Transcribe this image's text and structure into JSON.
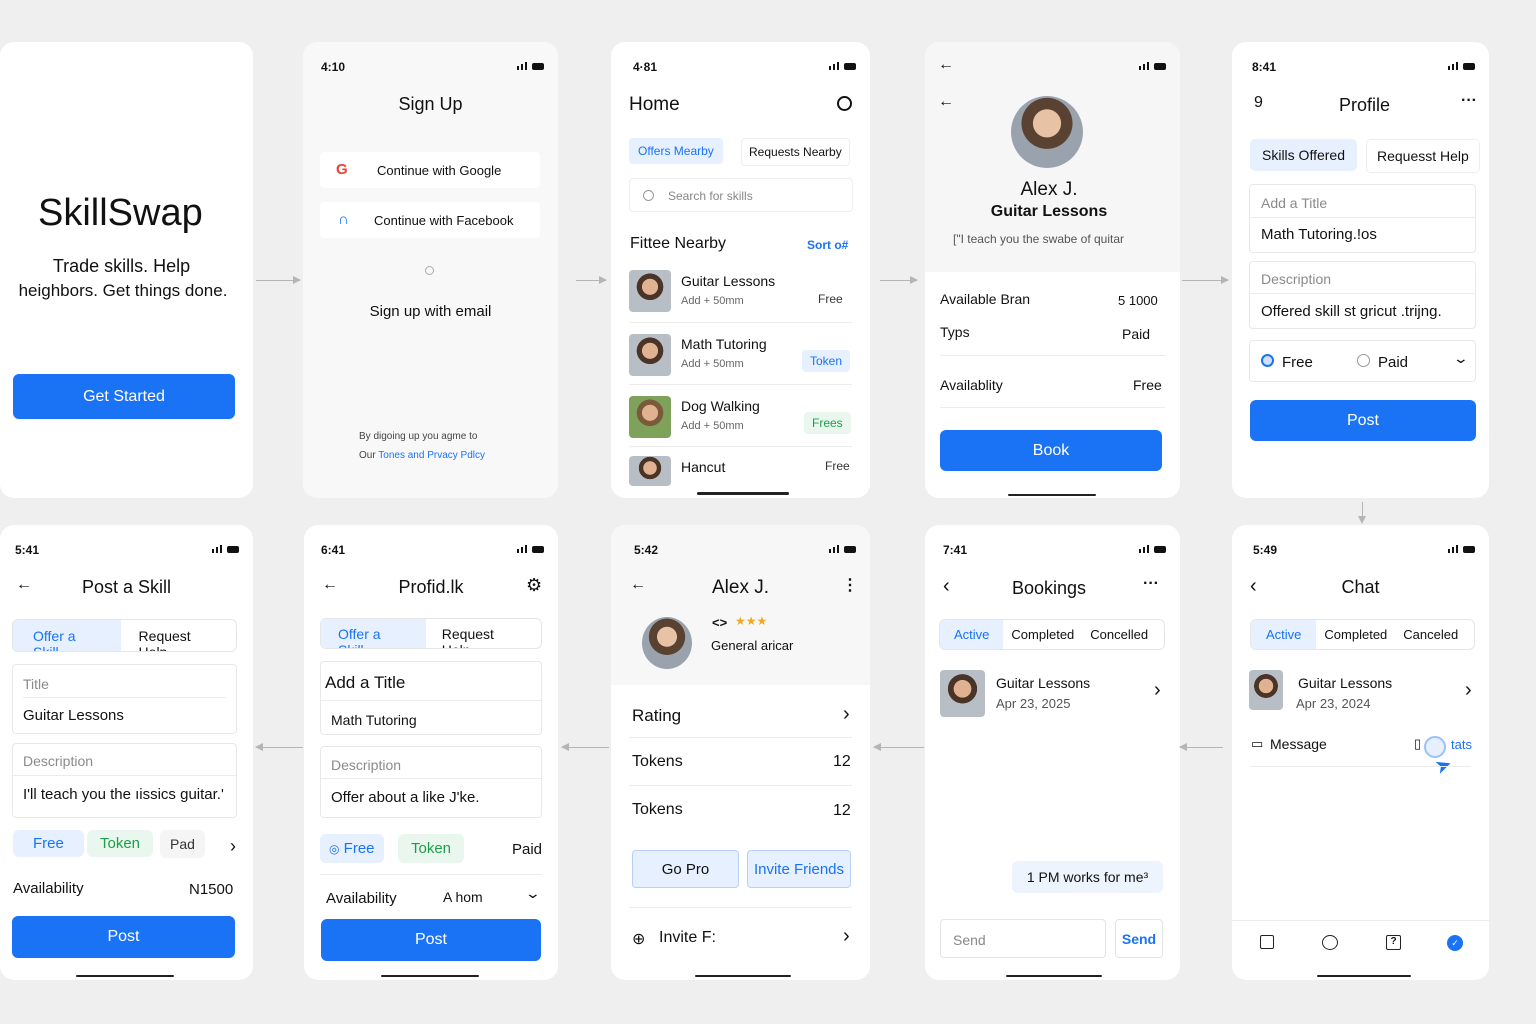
{
  "s1": {
    "title": "SkillSwap",
    "tag1": "Trade skills. Help",
    "tag2": "heighbors. Get things done.",
    "cta": "Get Started"
  },
  "s2": {
    "time": "4:10",
    "title": "Sign Up",
    "google": "Continue with Google",
    "facebook": "Continue with Facebook",
    "email": "Sign up with email",
    "legal1": "By digoing up  you agme to",
    "legal2a": "Our ",
    "legal2b": "Tones and Prvacy Pdlcy"
  },
  "s3": {
    "time": "4·81",
    "title": "Home",
    "tab1": "Offers Mearby",
    "tab2": "Requests Nearby",
    "search": "Search for skills",
    "section": "Fittee Nearby",
    "sort": "Sort o#",
    "items": [
      {
        "title": "Guitar Lessons",
        "sub": "Add + 50mm",
        "tag": "Free"
      },
      {
        "title": "Math Tutoring",
        "sub": "Add + 50mm",
        "tag": "Token"
      },
      {
        "title": "Dog Walking",
        "sub": "Add + 50mm",
        "tag": "Frees"
      },
      {
        "title": "Hancut",
        "sub": "",
        "tag": "Free"
      }
    ]
  },
  "s4": {
    "name": "Alex J.",
    "skill": "Guitar Lessons",
    "quote": "[\"I teach you the swabe of quitar",
    "r1l": "Available Bran",
    "r1v": "5 1000",
    "r2l": "Typs",
    "r2v": "Paid",
    "r3l": "Availablity",
    "r3v": "Free",
    "cta": "Book"
  },
  "s5": {
    "time": "8:41",
    "badge": "9",
    "title": "Profile",
    "tab1": "Skills Offered",
    "tab2": "Requesst Help",
    "ph": "Add a Title",
    "title_val": "Math Tutoring.!os",
    "desc_lbl": "Description",
    "desc_val": "Offered skill st gricut .trijng.",
    "free": "Free",
    "paid": "Paid",
    "cta": "Post"
  },
  "s6": {
    "time": "5:41",
    "title": "Post a Skill",
    "tab1": "Offer a Skill",
    "tab2": "Request Help",
    "t_lbl": "Title",
    "t_val": "Guitar Lessons",
    "d_lbl": "Description",
    "d_val": "I'll teach you the ıissics guitar.'",
    "c1": "Free",
    "c2": "Token",
    "c3": "Pad",
    "avail_l": "Availability",
    "avail_v": "N1500",
    "cta": "Post"
  },
  "s7": {
    "time": "6:41",
    "title": "Profid.lk",
    "tab1": "Offer a Skill",
    "tab2": "Request Help",
    "t_lbl": "Add a Title",
    "t_val": "Math Tutoring",
    "d_lbl": "Description",
    "d_val": "Offer about a like J'ke.",
    "c1": "Free",
    "c2": "Token",
    "c3": "Paid",
    "avail_l": "Availability",
    "avail_v": "A hom",
    "cta": "Post"
  },
  "s8": {
    "time": "5:42",
    "name": "Alex J.",
    "stars": "★★★",
    "code": "<>",
    "sub": "General aricar",
    "r1": "Rating",
    "r2l": "Tokens",
    "r2v": "12",
    "r3l": "Tokens",
    "r3v": "12",
    "b1": "Go Pro",
    "b2": "Invite Friends",
    "r4": "Invite F:"
  },
  "s9": {
    "time": "7:41",
    "title": "Bookings",
    "tab1": "Active",
    "tab2": "Completed",
    "tab3": "Concelled",
    "item": "Guitar Lessons",
    "date": "Apr 23, 2025",
    "msg": "1 PM works for me³",
    "ph": "Send",
    "send": "Send"
  },
  "s10": {
    "time": "5:49",
    "title": "Chat",
    "tab1": "Active",
    "tab2": "Completed",
    "tab3": "Canceled",
    "item": "Guitar Lessons",
    "date": "Apr 23, 2024",
    "msg": "Message",
    "stats": "tats"
  },
  "colors": {
    "accent": "#1a73f5",
    "tint": "#e6f0ff",
    "green": "#1e9e4a"
  }
}
